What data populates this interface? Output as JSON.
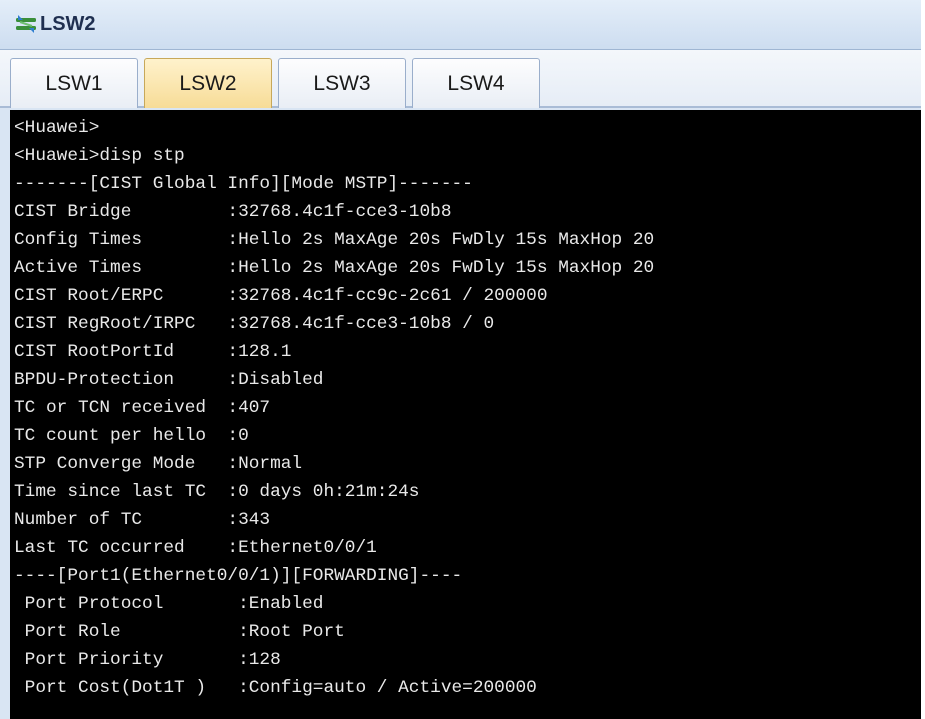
{
  "window": {
    "title": "LSW2",
    "icon": "switch-icon"
  },
  "tabs": [
    {
      "label": "LSW1",
      "active": false
    },
    {
      "label": "LSW2",
      "active": true
    },
    {
      "label": "LSW3",
      "active": false
    },
    {
      "label": "LSW4",
      "active": false
    }
  ],
  "terminal": {
    "background": "#000000",
    "foreground": "#e9e9e9",
    "lines": [
      "<Huawei>",
      "<Huawei>disp stp",
      "-------[CIST Global Info][Mode MSTP]-------",
      "CIST Bridge         :32768.4c1f-cce3-10b8",
      "Config Times        :Hello 2s MaxAge 20s FwDly 15s MaxHop 20",
      "Active Times        :Hello 2s MaxAge 20s FwDly 15s MaxHop 20",
      "CIST Root/ERPC      :32768.4c1f-cc9c-2c61 / 200000",
      "CIST RegRoot/IRPC   :32768.4c1f-cce3-10b8 / 0",
      "CIST RootPortId     :128.1",
      "BPDU-Protection     :Disabled",
      "TC or TCN received  :407",
      "TC count per hello  :0",
      "STP Converge Mode   :Normal",
      "Time since last TC  :0 days 0h:21m:24s",
      "Number of TC        :343",
      "Last TC occurred    :Ethernet0/0/1",
      "----[Port1(Ethernet0/0/1)][FORWARDING]----",
      " Port Protocol       :Enabled",
      " Port Role           :Root Port",
      " Port Priority       :128",
      " Port Cost(Dot1T )   :Config=auto / Active=200000"
    ]
  }
}
